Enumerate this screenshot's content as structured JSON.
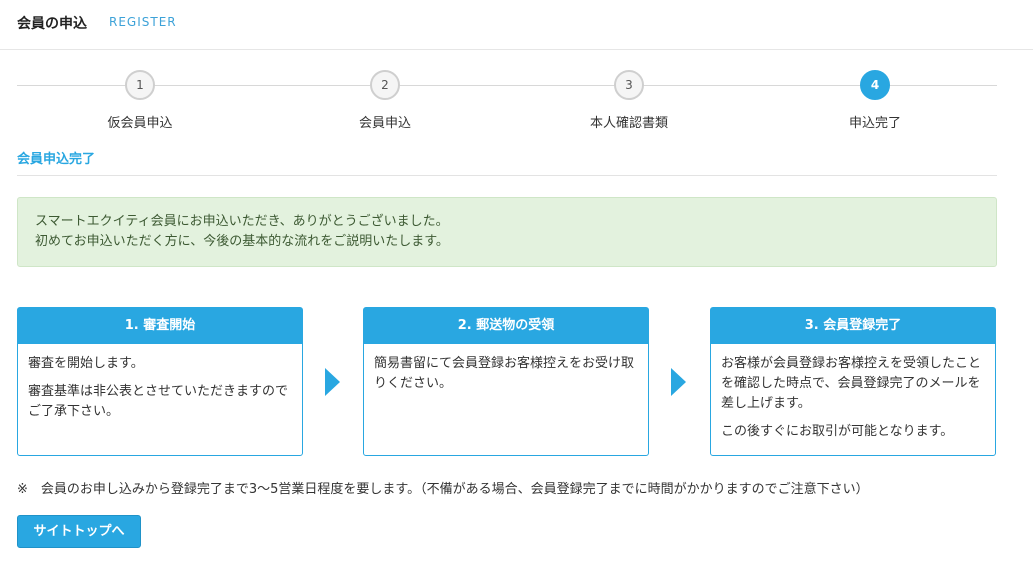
{
  "header": {
    "title": "会員の申込",
    "subtitle": "REGISTER"
  },
  "steps": [
    {
      "number": "1",
      "label": "仮会員申込",
      "active": false
    },
    {
      "number": "2",
      "label": "会員申込",
      "active": false
    },
    {
      "number": "3",
      "label": "本人確認書類",
      "active": false
    },
    {
      "number": "4",
      "label": "申込完了",
      "active": true
    }
  ],
  "section": {
    "title": "会員申込完了"
  },
  "notice": {
    "line1": "スマートエクイティ会員にお申込いただき、ありがとうございました。",
    "line2": "初めてお申込いただく方に、今後の基本的な流れをご説明いたします。"
  },
  "cards": [
    {
      "title": "1. 審査開始",
      "paragraphs": [
        "審査を開始します。",
        "審査基準は非公表とさせていただきますのでご了承下さい。"
      ]
    },
    {
      "title": "2. 郵送物の受領",
      "paragraphs": [
        "簡易書留にて会員登録お客様控えをお受け取りください。"
      ]
    },
    {
      "title": "3. 会員登録完了",
      "paragraphs": [
        "お客様が会員登録お客様控えを受領したことを確認した時点で、会員登録完了のメールを差し上げます。",
        "この後すぐにお取引が可能となります。"
      ]
    }
  ],
  "footnote": "※　会員のお申し込みから登録完了まで3〜5営業日程度を要します。（不備がある場合、会員登録完了までに時間がかかりますのでご注意下さい）",
  "button": {
    "label": "サイトトップへ"
  },
  "colors": {
    "accent": "#29a7e1",
    "notice_bg": "#e3f2de",
    "notice_text": "#3d5a33"
  }
}
